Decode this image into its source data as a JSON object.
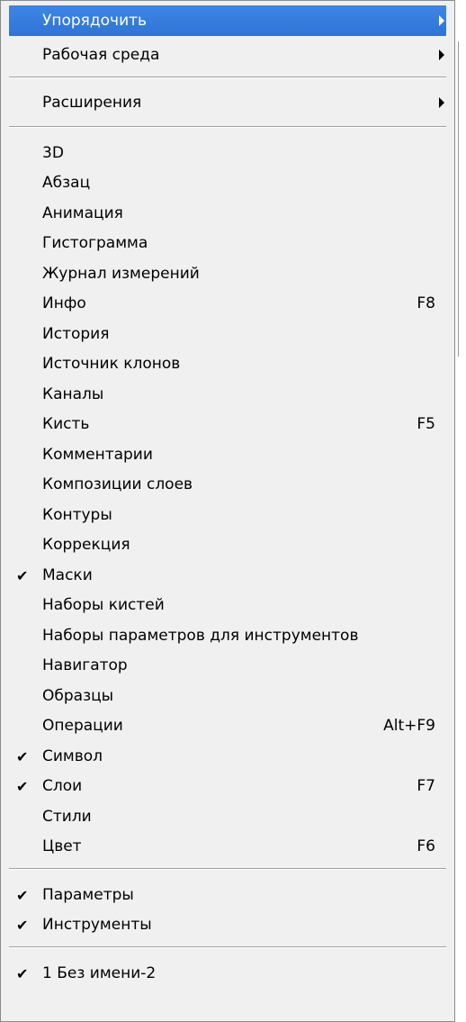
{
  "menu": {
    "items": [
      {
        "label": "Упорядочить",
        "submenu": true,
        "highlighted": true
      },
      {
        "label": "Рабочая среда",
        "submenu": true
      },
      {
        "label": "Расширения",
        "submenu": true
      },
      {
        "label": "3D"
      },
      {
        "label": "Абзац"
      },
      {
        "label": "Анимация"
      },
      {
        "label": "Гистограмма"
      },
      {
        "label": "Журнал измерений"
      },
      {
        "label": "Инфо",
        "shortcut": "F8"
      },
      {
        "label": "История"
      },
      {
        "label": "Источник клонов"
      },
      {
        "label": "Каналы"
      },
      {
        "label": "Кисть",
        "shortcut": "F5"
      },
      {
        "label": "Комментарии"
      },
      {
        "label": "Композиции слоев"
      },
      {
        "label": "Контуры"
      },
      {
        "label": "Коррекция"
      },
      {
        "label": "Маски",
        "checked": true
      },
      {
        "label": "Наборы кистей"
      },
      {
        "label": "Наборы параметров для инструментов"
      },
      {
        "label": "Навигатор"
      },
      {
        "label": "Образцы"
      },
      {
        "label": "Операции",
        "shortcut": "Alt+F9"
      },
      {
        "label": "Символ",
        "checked": true
      },
      {
        "label": "Слои",
        "shortcut": "F7",
        "checked": true
      },
      {
        "label": "Стили"
      },
      {
        "label": "Цвет",
        "shortcut": "F6"
      },
      {
        "label": "Параметры",
        "checked": true
      },
      {
        "label": "Инструменты",
        "checked": true
      },
      {
        "label": "1 Без имени-2",
        "checked": true
      }
    ],
    "check_glyph": "✔",
    "highlight_color": "#3379dc"
  }
}
